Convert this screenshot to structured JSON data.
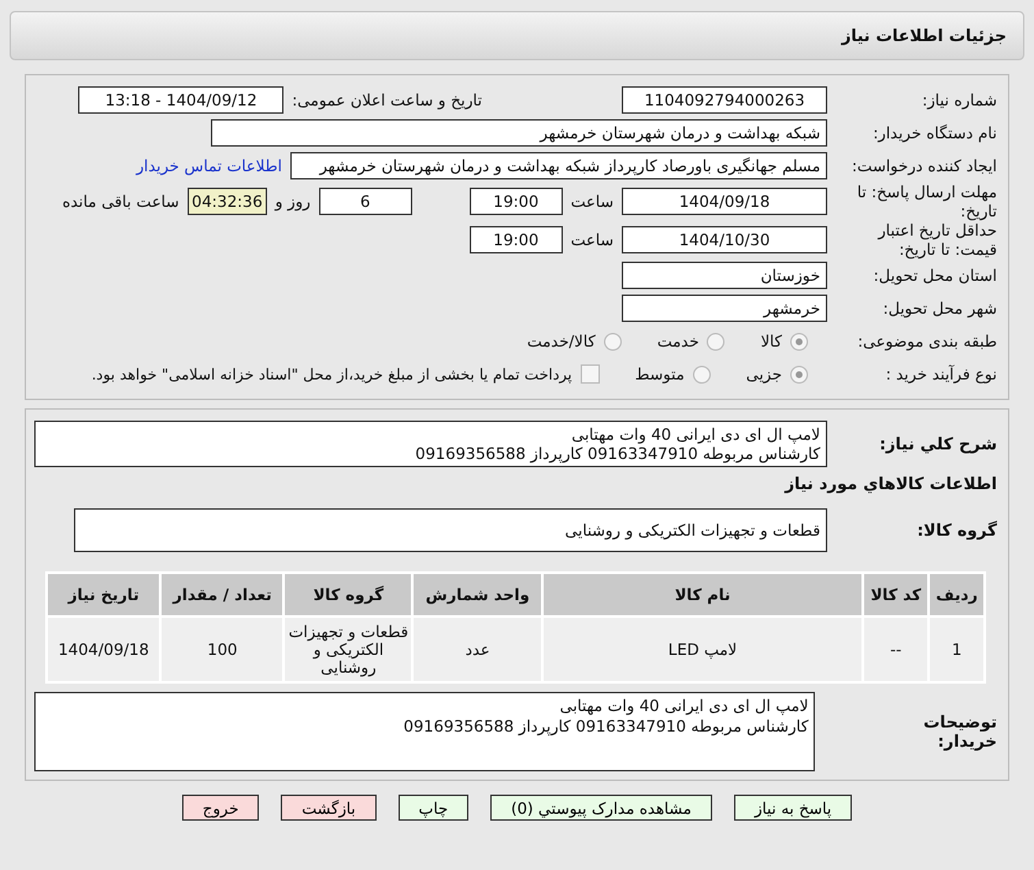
{
  "header": {
    "title": "جزئیات اطلاعات نیاز"
  },
  "need_number": {
    "label": "شماره نیاز:",
    "value": "1104092794000263"
  },
  "announce": {
    "label": "تاریخ و ساعت اعلان عمومی:",
    "value": "1404/09/12 - 13:18"
  },
  "buyer": {
    "label": "نام دستگاه خریدار:",
    "value": "شبکه بهداشت و درمان شهرستان خرمشهر"
  },
  "creator": {
    "label": "ایجاد کننده درخواست:",
    "value": "مسلم جهانگیری باورصاد کارپرداز شبکه بهداشت و درمان شهرستان خرمشهر",
    "link": "اطلاعات تماس خریدار"
  },
  "deadline": {
    "label": "مهلت ارسال پاسخ: تا تاریخ:",
    "date": "1404/09/18",
    "time_label": "ساعت",
    "time": "19:00",
    "days": "6",
    "days_label": "روز و",
    "remaining": "04:32:36",
    "remaining_label": "ساعت باقی مانده"
  },
  "validity": {
    "label": "حداقل تاریخ اعتبار قیمت: تا تاریخ:",
    "date": "1404/10/30",
    "time_label": "ساعت",
    "time": "19:00"
  },
  "province": {
    "label": "استان محل تحویل:",
    "value": "خوزستان"
  },
  "city": {
    "label": "شهر محل تحویل:",
    "value": "خرمشهر"
  },
  "category": {
    "label": "طبقه بندی موضوعی:",
    "options": [
      {
        "label": "کالا",
        "selected": true
      },
      {
        "label": "خدمت",
        "selected": false
      },
      {
        "label": "کالا/خدمت",
        "selected": false
      }
    ]
  },
  "process": {
    "label": "نوع فرآیند خرید :",
    "options": [
      {
        "label": "جزیی",
        "selected": true
      },
      {
        "label": "متوسط",
        "selected": false
      }
    ],
    "payment": {
      "label": "پرداخت تمام یا بخشی از مبلغ خرید،از محل \"اسناد خزانه اسلامی\" خواهد بود.",
      "checked": false
    }
  },
  "description": {
    "label": "شرح كلي نياز:",
    "value": "لامپ ال ای دی ایرانی 40 وات مهتابی\nکارشناس مربوطه 09163347910 کارپرداز 09169356588"
  },
  "goods": {
    "title": "اطلاعات کالاهاي مورد نياز",
    "group_label": "گروه کالا:",
    "group_value": "قطعات و تجهیزات الکتریکی و روشنایی"
  },
  "table": {
    "columns": [
      "ردیف",
      "کد کالا",
      "نام کالا",
      "واحد شمارش",
      "گروه کالا",
      "تعداد / مقدار",
      "تاریخ نیاز"
    ],
    "rows": [
      [
        "1",
        "--",
        "لامپ LED",
        "عدد",
        "قطعات و تجهیزات الکتریکی و روشنایی",
        "100",
        "1404/09/18"
      ]
    ]
  },
  "buyer_notes": {
    "label": "توضیحات خریدار:",
    "value": "لامپ ال ای دی ایرانی 40 وات مهتابی\nکارشناس مربوطه 09163347910 کارپرداز 09169356588"
  },
  "buttons": [
    {
      "label": "پاسخ به نیاز",
      "kind": "primary"
    },
    {
      "label": "مشاهده مدارک پیوستي (0)",
      "kind": "primary"
    },
    {
      "label": "چاپ",
      "kind": "primary"
    },
    {
      "label": "بازگشت",
      "kind": "danger"
    },
    {
      "label": "خروج",
      "kind": "danger"
    }
  ]
}
